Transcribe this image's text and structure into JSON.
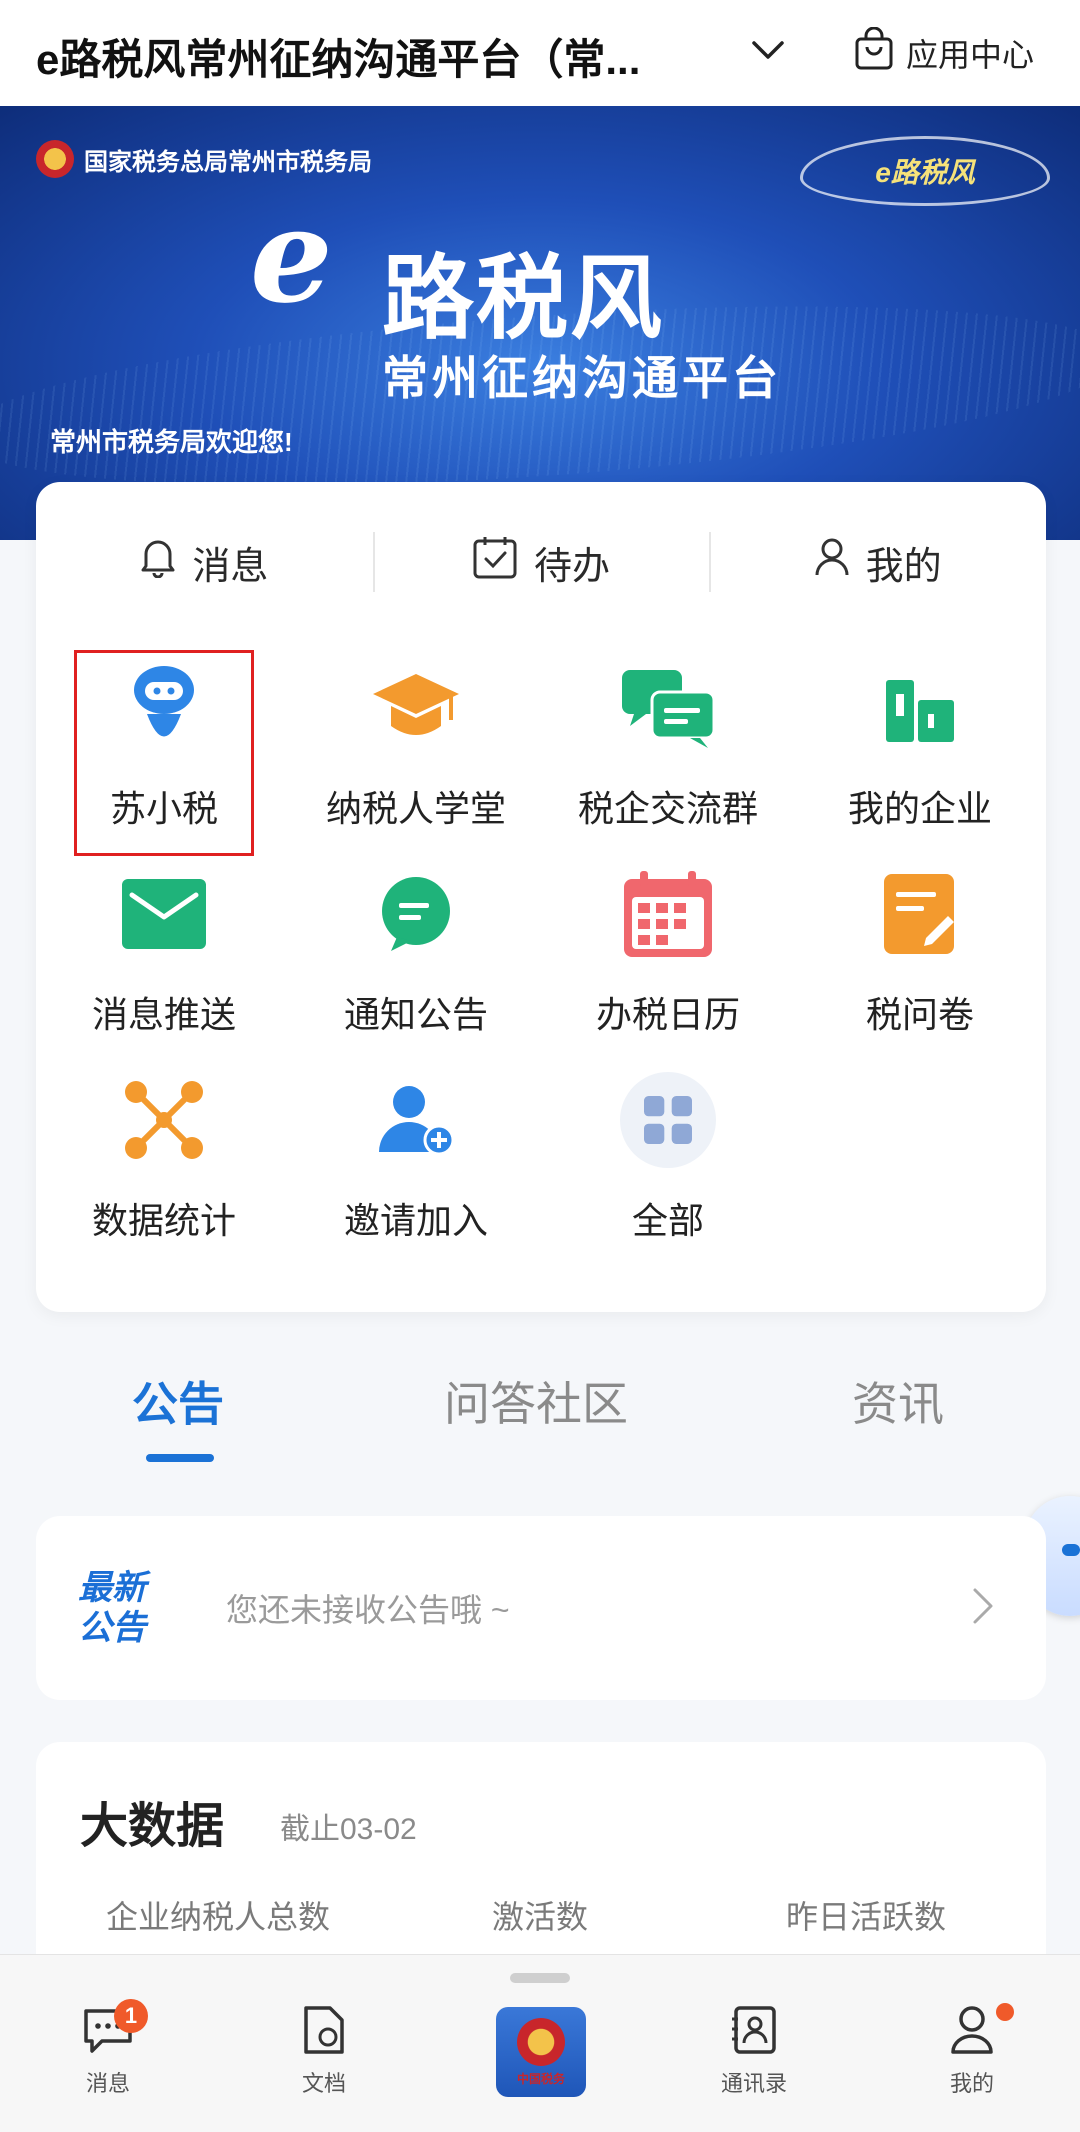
{
  "header": {
    "title": "e路税风常州征纳沟通平台（常...",
    "app_center_label": "应用中心"
  },
  "banner": {
    "org_name": "国家税务总局常州市税务局",
    "brand_small": "e路税风",
    "brand_e": "e",
    "brand_main": "路税风",
    "brand_sub": "常州征纳沟通平台",
    "welcome": "常州市税务局欢迎您!"
  },
  "quick_actions": [
    {
      "label": "消息",
      "icon": "bell-icon"
    },
    {
      "label": "待办",
      "icon": "calendar-check-icon"
    },
    {
      "label": "我的",
      "icon": "user-icon"
    }
  ],
  "apps": [
    {
      "label": "苏小税",
      "icon": "robot-icon",
      "color": "#2e86e6"
    },
    {
      "label": "纳税人学堂",
      "icon": "graduation-cap-icon",
      "color": "#f39a2e"
    },
    {
      "label": "税企交流群",
      "icon": "chat-bubbles-icon",
      "color": "#1fb37a"
    },
    {
      "label": "我的企业",
      "icon": "building-icon",
      "color": "#1fb37a"
    },
    {
      "label": "消息推送",
      "icon": "mail-icon",
      "color": "#1fb37a"
    },
    {
      "label": "通知公告",
      "icon": "chat-bubble-icon",
      "color": "#1fb37a"
    },
    {
      "label": "办税日历",
      "icon": "calendar-icon",
      "color": "#f0676d"
    },
    {
      "label": "税问卷",
      "icon": "form-edit-icon",
      "color": "#f39a2e"
    },
    {
      "label": "数据统计",
      "icon": "network-icon",
      "color": "#f39a2e"
    },
    {
      "label": "邀请加入",
      "icon": "add-user-icon",
      "color": "#2e86e6"
    },
    {
      "label": "全部",
      "icon": "grid-icon",
      "color": "#8fa8d6"
    }
  ],
  "tabs": [
    "公告",
    "问答社区",
    "资讯"
  ],
  "active_tab": "公告",
  "notice": {
    "badge_line1": "最新",
    "badge_line2": "公告",
    "text": "您还未接收公告哦 ~"
  },
  "bigdata": {
    "title": "大数据",
    "date": "截止03-02",
    "columns": [
      "企业纳税人总数",
      "激活数",
      "昨日活跃数"
    ]
  },
  "bottom_nav": [
    {
      "label": "消息",
      "icon": "message-icon",
      "badge": "1"
    },
    {
      "label": "文档",
      "icon": "document-icon"
    },
    {
      "label": "",
      "icon": "tax-emblem-icon",
      "logo_text": "中国税务"
    },
    {
      "label": "通讯录",
      "icon": "contacts-icon"
    },
    {
      "label": "我的",
      "icon": "profile-icon"
    }
  ],
  "colors": {
    "accent": "#1b72d6",
    "highlight_border": "#e02020",
    "badge": "#f05a2a"
  }
}
